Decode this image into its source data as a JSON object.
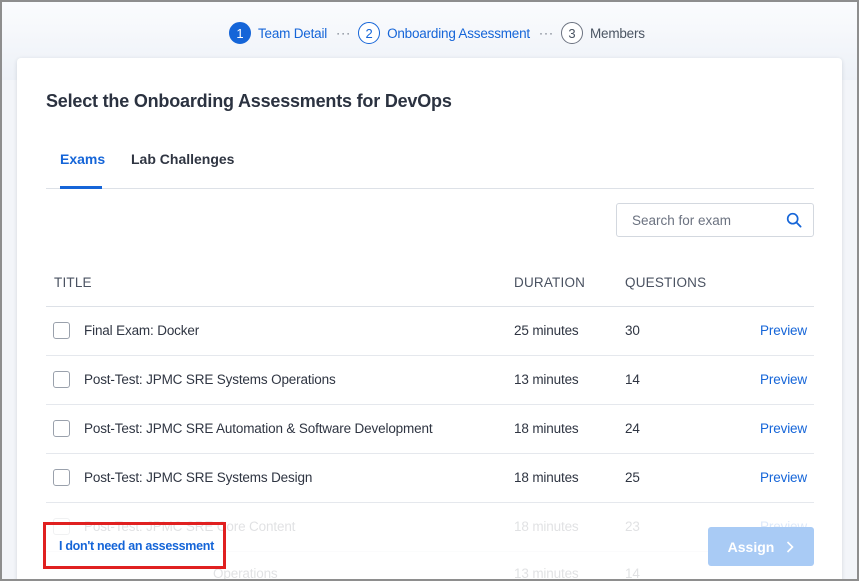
{
  "stepper": {
    "steps": [
      {
        "num": "1",
        "label": "Team Detail"
      },
      {
        "num": "2",
        "label": "Onboarding Assessment"
      },
      {
        "num": "3",
        "label": "Members"
      }
    ],
    "separator": "···"
  },
  "card": {
    "title": "Select the Onboarding Assessments for DevOps"
  },
  "tabs": [
    {
      "label": "Exams",
      "active": true
    },
    {
      "label": "Lab Challenges",
      "active": false
    }
  ],
  "search": {
    "placeholder": "Search for exam",
    "value": "",
    "icon": "search-icon"
  },
  "table": {
    "headers": {
      "title": "TITLE",
      "duration": "DURATION",
      "questions": "QUESTIONS"
    },
    "rows": [
      {
        "title": "Final Exam: Docker",
        "duration": "25 minutes",
        "questions": "30",
        "action": "Preview"
      },
      {
        "title": "Post-Test: JPMC SRE Systems Operations",
        "duration": "13 minutes",
        "questions": "14",
        "action": "Preview"
      },
      {
        "title": "Post-Test: JPMC SRE Automation & Software Development",
        "duration": "18 minutes",
        "questions": "24",
        "action": "Preview"
      },
      {
        "title": "Post-Test: JPMC SRE Systems Design",
        "duration": "18 minutes",
        "questions": "25",
        "action": "Preview"
      },
      {
        "title": "Post-Test: JPMC SRE Core Content",
        "duration": "18 minutes",
        "questions": "23",
        "action": "Preview"
      },
      {
        "title": "Operations",
        "duration": "13 minutes",
        "questions": "14",
        "action": ""
      }
    ]
  },
  "footer": {
    "no_assessment_link": "I don't need an assessment",
    "assign_label": "Assign"
  },
  "colors": {
    "accent": "#1565d8",
    "assign_disabled": "#a9cbf5",
    "highlight": "#e02020"
  }
}
